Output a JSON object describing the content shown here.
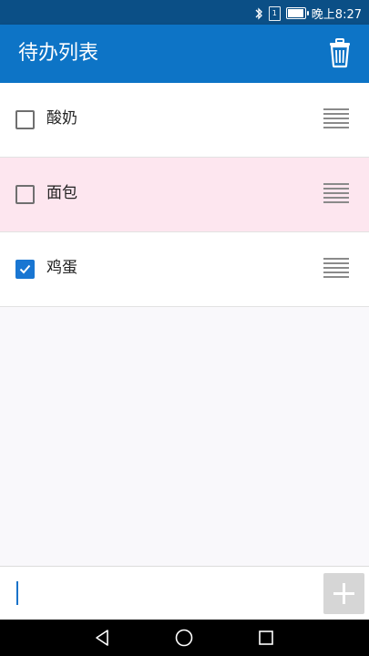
{
  "status_bar": {
    "time": "晚上8:27",
    "sim_label": "1"
  },
  "app_bar": {
    "title": "待办列表"
  },
  "todos": [
    {
      "label": "酸奶",
      "checked": false
    },
    {
      "label": "面包",
      "checked": false
    },
    {
      "label": "鸡蛋",
      "checked": true
    }
  ],
  "input": {
    "value": "",
    "placeholder": ""
  },
  "colors": {
    "status_bar": "#0b4f86",
    "app_bar": "#0d74c6",
    "highlight_row": "#fde6ef",
    "checkbox_checked": "#1976d2",
    "add_button": "#d6d6d6"
  },
  "icons": [
    "bluetooth-icon",
    "sim-icon",
    "battery-icon",
    "trash-icon",
    "checkbox-icon",
    "drag-handle-icon",
    "add-icon",
    "back-icon",
    "home-icon",
    "recent-apps-icon"
  ]
}
